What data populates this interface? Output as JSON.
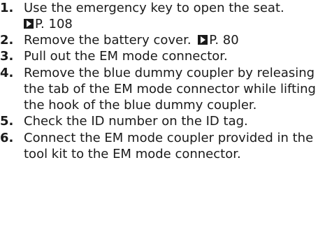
{
  "steps": [
    {
      "number": "1.",
      "text": "Use the emergency key to open the seat.",
      "ref": "P. 108"
    },
    {
      "number": "2.",
      "text": "Remove the battery cover.",
      "ref": "P. 80"
    },
    {
      "number": "3.",
      "text": "Pull out the EM mode connector."
    },
    {
      "number": "4.",
      "text": "Remove the blue dummy coupler by releasing the tab of the EM mode connector while lifting the hook of the blue dummy coupler."
    },
    {
      "number": "5.",
      "text": "Check the ID number on the ID tag."
    },
    {
      "number": "6.",
      "text": "Connect the EM mode coupler provided in the tool kit to the EM mode connector."
    }
  ]
}
